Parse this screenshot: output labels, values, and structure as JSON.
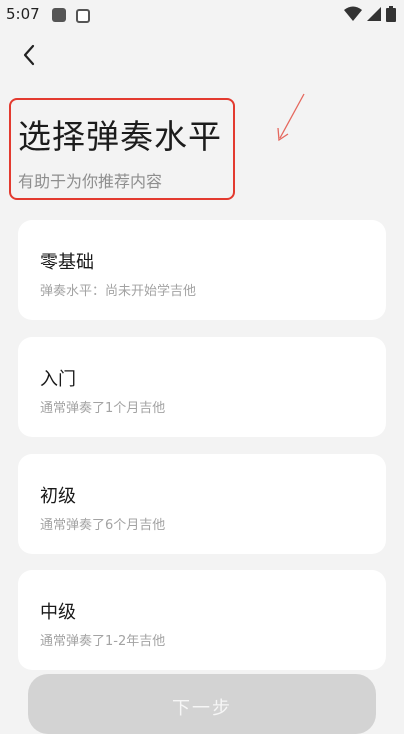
{
  "status_bar": {
    "time": "5:07",
    "icons": [
      "app-notification-icon",
      "a-badge-icon",
      "wifi-icon",
      "signal-icon",
      "battery-icon"
    ]
  },
  "header": {
    "title": "选择弹奏水平",
    "subtitle": "有助于为你推荐内容"
  },
  "options": [
    {
      "title": "零基础",
      "desc": "弹奏水平：尚未开始学吉他"
    },
    {
      "title": "入门",
      "desc": "通常弹奏了1个月吉他"
    },
    {
      "title": "初级",
      "desc": "通常弹奏了6个月吉他"
    },
    {
      "title": "中级",
      "desc": "通常弹奏了1-2年吉他"
    }
  ],
  "footer": {
    "next_label": "下一步"
  },
  "colors": {
    "background": "#f3f3f3",
    "card": "#ffffff",
    "highlight_box": "#e33a2f",
    "disabled_button": "#d3d3d3"
  }
}
